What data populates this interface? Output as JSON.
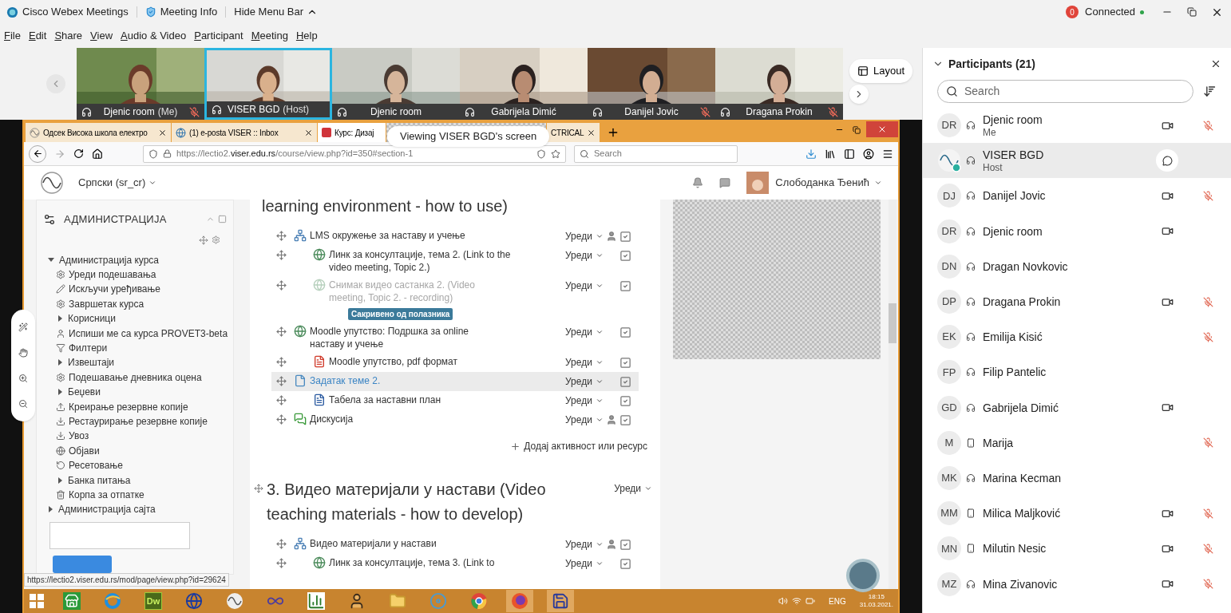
{
  "titlebar": {
    "app_title": "Cisco Webex Meetings",
    "meeting_info": "Meeting Info",
    "hide_menu": "Hide Menu Bar",
    "alerts": "0",
    "status": "Connected"
  },
  "menu": [
    "File",
    "Edit",
    "Share",
    "View",
    "Audio & Video",
    "Participant",
    "Meeting",
    "Help"
  ],
  "video_strip": {
    "layout_button": "Layout",
    "tiles": [
      {
        "name": "Djenic room",
        "tag": "(Me)",
        "muted": true,
        "active": false
      },
      {
        "name": "VISER BGD",
        "tag": "(Host)",
        "muted": false,
        "active": true
      },
      {
        "name": "Djenic room",
        "muted": false,
        "active": false
      },
      {
        "name": "Gabrijela Dimić",
        "muted": false,
        "active": false
      },
      {
        "name": "Danijel Jovic",
        "muted": true,
        "active": false
      },
      {
        "name": "Dragana Prokin",
        "muted": true,
        "active": false
      }
    ]
  },
  "shared_screen": {
    "banner": "Viewing VISER BGD's screen",
    "browser": {
      "tabs": [
        {
          "label": "Одсек Висока школа електро",
          "selected": false
        },
        {
          "label": "(1) e-posta VISER :: Inbox",
          "selected": false
        },
        {
          "label": "Курс: Дизај",
          "selected": true
        },
        {
          "label": "CTRICAL",
          "selected": false
        }
      ],
      "url_start": "https://lectio2.",
      "url_host": "viser.edu.rs",
      "url_path": "/course/view.php?id=350#section-1",
      "search_placeholder": "Search"
    },
    "moodle": {
      "language": "Српски (sr_cr)",
      "user": "Слободанка Ђенић",
      "admin": {
        "title": "АДМИНИСТРАЦИЈА",
        "tree": [
          {
            "label": "Администрација курса",
            "kind": "branch",
            "expanded": true,
            "children": [
              {
                "label": "Уреди подешавања",
                "kind": "gear"
              },
              {
                "label": "Искључи уређивање",
                "kind": "pencil"
              },
              {
                "label": "Завршетак курса",
                "kind": "gear"
              },
              {
                "label": "Корисници",
                "kind": "branch",
                "expanded": false
              },
              {
                "label": "Испиши ме са курса PROVET3-beta",
                "kind": "user"
              },
              {
                "label": "Филтери",
                "kind": "filter"
              },
              {
                "label": "Извештаји",
                "kind": "branch",
                "expanded": false
              },
              {
                "label": "Подешавање дневника оцена",
                "kind": "gear"
              },
              {
                "label": "Беџеви",
                "kind": "branch",
                "expanded": false
              },
              {
                "label": "Креирање резервне копије",
                "kind": "upload"
              },
              {
                "label": "Рестаурирање резервне копије",
                "kind": "download"
              },
              {
                "label": "Увоз",
                "kind": "download"
              },
              {
                "label": "Објави",
                "kind": "globe"
              },
              {
                "label": "Ресетовање",
                "kind": "reset"
              },
              {
                "label": "Банка питања",
                "kind": "branch",
                "expanded": false
              },
              {
                "label": "Корпа за отпатке",
                "kind": "trash"
              }
            ]
          },
          {
            "label": "Администрација сајта",
            "kind": "branch",
            "expanded": false
          }
        ]
      },
      "sections": [
        {
          "title": "learning environment - how to use)",
          "add_activity": "Додај активност или ресурс",
          "activities": [
            {
              "kind": "lms",
              "text": "LMS окружење за наставу и учење",
              "edit": "Уреди",
              "restricted": true,
              "checked": true,
              "dimmed": false,
              "link": false,
              "highlighted": false,
              "children": [
                {
                  "kind": "url",
                  "text": "Линк за консултације, тема 2. (Link to the video meeting, Topic 2.)",
                  "edit": "Уреди",
                  "restricted": false,
                  "checked": true,
                  "dimmed": false,
                  "link": false,
                  "highlighted": false
                },
                {
                  "kind": "url",
                  "text": "Снимак видео састанка 2. (Video meeting, Topic 2. - recording)",
                  "badge": "Сакривено од полазника",
                  "edit": "Уреди",
                  "restricted": false,
                  "checked": true,
                  "dimmed": true,
                  "link": false,
                  "highlighted": false
                }
              ]
            },
            {
              "kind": "url",
              "text": "Moodle упутство: Подршка за online наставу и учење",
              "edit": "Уреди",
              "restricted": false,
              "checked": true,
              "dimmed": false,
              "link": false,
              "highlighted": false,
              "children": [
                {
                  "kind": "pdf",
                  "text": "Moodle упутство, pdf формат",
                  "edit": "Уреди",
                  "restricted": false,
                  "checked": true,
                  "dimmed": false,
                  "link": false,
                  "highlighted": false
                }
              ]
            },
            {
              "kind": "page",
              "text": "Задатак теме 2.",
              "edit": "Уреди",
              "restricted": false,
              "checked": true,
              "dimmed": false,
              "link": true,
              "highlighted": true,
              "children": [
                {
                  "kind": "word",
                  "text": "Табела за наставни план",
                  "edit": "Уреди",
                  "restricted": false,
                  "checked": true,
                  "dimmed": false,
                  "link": false,
                  "highlighted": false
                }
              ]
            },
            {
              "kind": "forum",
              "text": "Дискусија",
              "edit": "Уреди",
              "restricted": true,
              "checked": true,
              "dimmed": false,
              "link": false,
              "highlighted": false
            }
          ]
        },
        {
          "title": "3. Видео материјали у настави (Video teaching materials - how to develop)",
          "edit": "Уреди",
          "activities": [
            {
              "kind": "lms",
              "text": "Видео материјали у настави",
              "edit": "Уреди",
              "restricted": true,
              "checked": true,
              "dimmed": false,
              "link": false,
              "highlighted": false,
              "children": [
                {
                  "kind": "url",
                  "text": "Линк за консултације, тема 3. (Link to",
                  "edit": "Уреди",
                  "restricted": false,
                  "checked": true,
                  "dimmed": false,
                  "link": false,
                  "highlighted": false
                }
              ]
            }
          ]
        }
      ]
    },
    "status_url": "https://lectio2.viser.edu.rs/mod/page/view.php?id=29624",
    "taskbar": {
      "apps": [
        {
          "kind": "store",
          "selected": false
        },
        {
          "kind": "ie",
          "selected": false
        },
        {
          "kind": "dw",
          "label": "Dw",
          "selected": false
        },
        {
          "kind": "globe",
          "selected": false
        },
        {
          "kind": "wave",
          "selected": false
        },
        {
          "kind": "infinity",
          "selected": false
        },
        {
          "kind": "chart",
          "selected": false
        },
        {
          "kind": "person",
          "selected": false
        },
        {
          "kind": "folder",
          "selected": false
        },
        {
          "kind": "disc",
          "selected": false
        },
        {
          "kind": "chrome",
          "selected": false
        },
        {
          "kind": "firefox",
          "selected": true
        },
        {
          "kind": "floppy",
          "selected": true
        }
      ],
      "language": "ENG",
      "time": "18:15",
      "date": "31.03.2021."
    }
  },
  "participants": {
    "title": "Participants (21)",
    "search_placeholder": "Search",
    "people": [
      {
        "kind": "initials",
        "initials": "DR",
        "name": "Djenic room",
        "role": "Me",
        "phone": false,
        "video": true,
        "muted": true,
        "chat": false,
        "selected": false
      },
      {
        "kind": "logo",
        "name": "VISER BGD",
        "role": "Host",
        "phone": false,
        "video": false,
        "muted": false,
        "chat": true,
        "selected": true
      },
      {
        "kind": "initials",
        "initials": "DJ",
        "name": "Danijel Jovic",
        "phone": false,
        "video": true,
        "muted": true,
        "chat": false,
        "selected": false
      },
      {
        "kind": "initials",
        "initials": "DR",
        "name": "Djenic room",
        "phone": false,
        "video": true,
        "muted": false,
        "chat": false,
        "selected": false
      },
      {
        "kind": "initials",
        "initials": "DN",
        "name": "Dragan Novkovic",
        "phone": false,
        "video": false,
        "muted": false,
        "chat": false,
        "selected": false
      },
      {
        "kind": "initials",
        "initials": "DP",
        "name": "Dragana Prokin",
        "phone": false,
        "video": true,
        "muted": true,
        "chat": false,
        "selected": false
      },
      {
        "kind": "initials",
        "initials": "EK",
        "name": "Emilija Kisić",
        "phone": false,
        "video": false,
        "muted": true,
        "chat": false,
        "selected": false
      },
      {
        "kind": "initials",
        "initials": "FP",
        "name": "Filip Pantelic",
        "phone": false,
        "video": false,
        "muted": false,
        "chat": false,
        "selected": false
      },
      {
        "kind": "initials",
        "initials": "GD",
        "name": "Gabrijela Dimić",
        "phone": false,
        "video": true,
        "muted": false,
        "chat": false,
        "selected": false
      },
      {
        "kind": "initials",
        "initials": "M",
        "name": "Marija",
        "phone": true,
        "video": false,
        "muted": true,
        "chat": false,
        "selected": false
      },
      {
        "kind": "initials",
        "initials": "MK",
        "name": "Marina Kecman",
        "phone": false,
        "video": false,
        "muted": false,
        "chat": false,
        "selected": false
      },
      {
        "kind": "initials",
        "initials": "MM",
        "name": "Milica Maljković",
        "phone": true,
        "video": true,
        "muted": true,
        "chat": false,
        "selected": false
      },
      {
        "kind": "initials",
        "initials": "MN",
        "name": "Milutin Nesic",
        "phone": true,
        "video": true,
        "muted": true,
        "chat": false,
        "selected": false
      },
      {
        "kind": "initials",
        "initials": "MZ",
        "name": "Mina Zivanovic",
        "phone": false,
        "video": true,
        "muted": true,
        "chat": false,
        "selected": false
      }
    ]
  }
}
